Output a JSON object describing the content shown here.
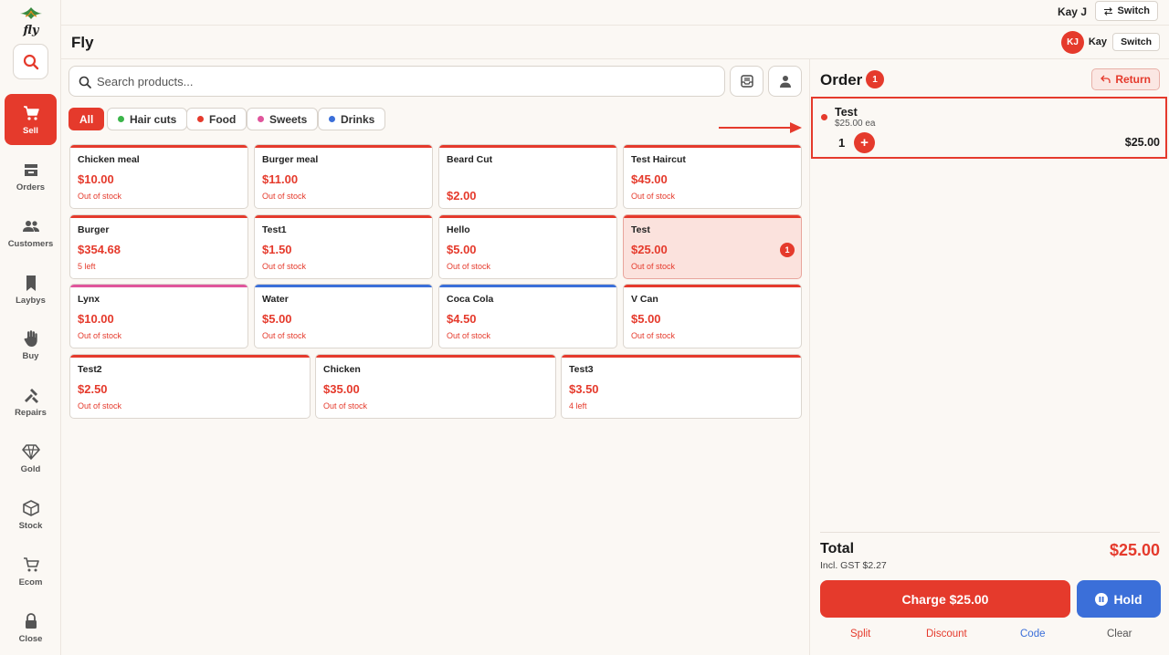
{
  "topbar": {
    "user": "Kay J",
    "switch_label": "Switch"
  },
  "sidebar": {
    "logo_text": "fly",
    "items": [
      {
        "label": "Sell",
        "icon": "cart-icon",
        "active": true
      },
      {
        "label": "Orders",
        "icon": "orders-icon"
      },
      {
        "label": "Customers",
        "icon": "customers-icon"
      },
      {
        "label": "Laybys",
        "icon": "bookmark-icon"
      },
      {
        "label": "Buy",
        "icon": "hand-icon"
      },
      {
        "label": "Repairs",
        "icon": "tools-icon"
      },
      {
        "label": "Gold",
        "icon": "diamond-icon"
      },
      {
        "label": "Stock",
        "icon": "box-icon"
      },
      {
        "label": "Ecom",
        "icon": "ecom-cart-icon"
      },
      {
        "label": "Close",
        "icon": "lock-icon"
      }
    ]
  },
  "header": {
    "title": "Fly",
    "avatar_initials": "KJ",
    "user": "Kay",
    "switch_label": "Switch"
  },
  "search": {
    "placeholder": "Search products..."
  },
  "categories": [
    {
      "label": "All",
      "active": true
    },
    {
      "label": "Hair cuts",
      "color": "#3bb54a"
    },
    {
      "label": "Food",
      "color": "#e53a2c"
    },
    {
      "label": "Sweets",
      "color": "#e0559c"
    },
    {
      "label": "Drinks",
      "color": "#3b6fd9"
    }
  ],
  "products": [
    {
      "name": "Chicken meal",
      "price": "$10.00",
      "stock": "Out of stock",
      "color": "#e53a2c"
    },
    {
      "name": "Burger meal",
      "price": "$11.00",
      "stock": "Out of stock",
      "color": "#e53a2c"
    },
    {
      "name": "Beard Cut",
      "price": "$2.00",
      "stock": "",
      "color": "#e53a2c"
    },
    {
      "name": "Test Haircut",
      "price": "$45.00",
      "stock": "Out of stock",
      "color": "#e53a2c"
    },
    {
      "name": "Burger",
      "price": "$354.68",
      "stock": "5 left",
      "color": "#e53a2c"
    },
    {
      "name": "Test1",
      "price": "$1.50",
      "stock": "Out of stock",
      "color": "#e53a2c"
    },
    {
      "name": "Hello",
      "price": "$5.00",
      "stock": "Out of stock",
      "color": "#e53a2c"
    },
    {
      "name": "Test",
      "price": "$25.00",
      "stock": "Out of stock",
      "color": "#e53a2c",
      "selected": true,
      "qty": "1"
    },
    {
      "name": "Lynx",
      "price": "$10.00",
      "stock": "Out of stock",
      "color": "#e0559c"
    },
    {
      "name": "Water",
      "price": "$5.00",
      "stock": "Out of stock",
      "color": "#3b6fd9"
    },
    {
      "name": "Coca Cola",
      "price": "$4.50",
      "stock": "Out of stock",
      "color": "#3b6fd9"
    },
    {
      "name": "V Can",
      "price": "$5.00",
      "stock": "Out of stock",
      "color": "#e53a2c"
    },
    {
      "name": "Test2",
      "price": "$2.50",
      "stock": "Out of stock",
      "color": "#e53a2c"
    },
    {
      "name": "Chicken",
      "price": "$35.00",
      "stock": "Out of stock",
      "color": "#e53a2c"
    },
    {
      "name": "Test3",
      "price": "$3.50",
      "stock": "4 left",
      "color": "#e53a2c"
    }
  ],
  "order": {
    "title": "Order",
    "count": "1",
    "return_label": "Return",
    "items": [
      {
        "name": "Test",
        "each": "$25.00 ea",
        "qty": "1",
        "line_total": "$25.00"
      }
    ],
    "total_label": "Total",
    "gst": "Incl. GST $2.27",
    "total": "$25.00",
    "charge_label": "Charge $25.00",
    "hold_label": "Hold",
    "footer": [
      {
        "label": "Split",
        "color": "#e53a2c"
      },
      {
        "label": "Discount",
        "color": "#e53a2c"
      },
      {
        "label": "Code",
        "color": "#3b6fd9"
      },
      {
        "label": "Clear",
        "color": "#555555"
      }
    ]
  },
  "colors": {
    "accent": "#e53a2c",
    "blue": "#3b6fd9",
    "background": "#fbf8f4"
  }
}
